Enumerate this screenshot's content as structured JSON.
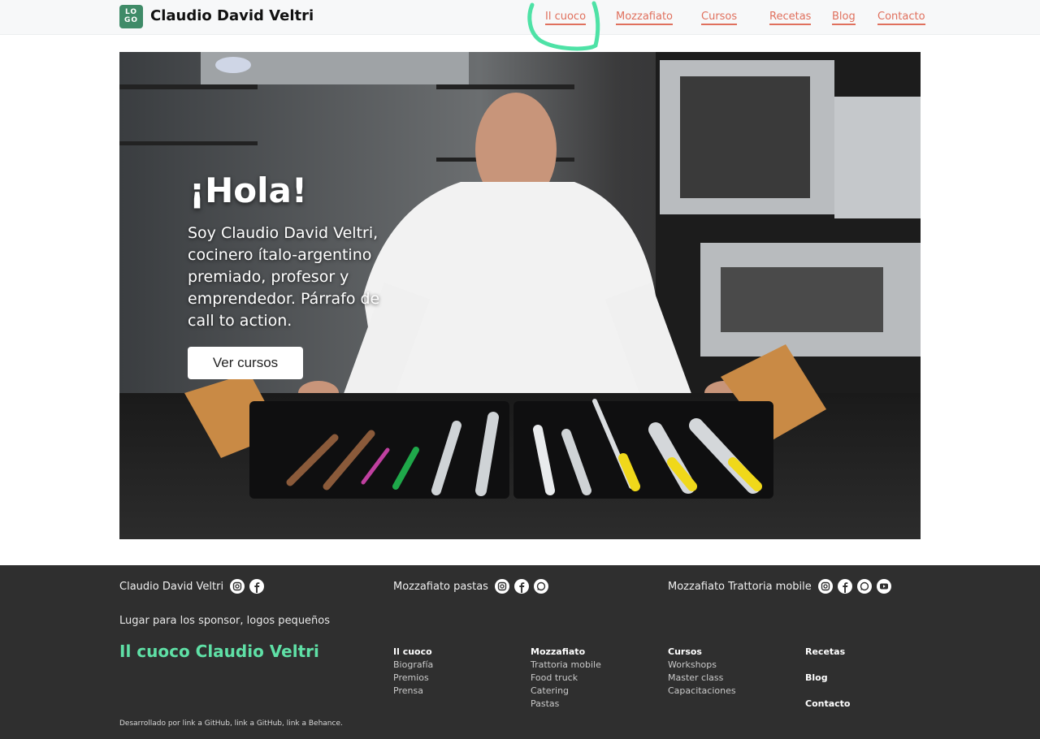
{
  "header": {
    "logo_text": [
      "LO",
      "GO"
    ],
    "brand": "Claudio David Veltri",
    "nav": [
      "Il cuoco",
      "Mozzafiato",
      "Cursos",
      "Recetas",
      "Blog",
      "Contacto"
    ]
  },
  "hero": {
    "title": "¡Hola!",
    "text": "Soy Claudio David Veltri, cocinero ítalo-argentino premiado, profesor y emprendedor. Párrafo de call to action.",
    "button": "Ver cursos"
  },
  "footer": {
    "col1": {
      "title": "Claudio David Veltri",
      "icons": [
        "instagram-icon",
        "facebook-icon"
      ]
    },
    "col2": {
      "title": "Mozzafiato pastas",
      "icons": [
        "instagram-icon",
        "facebook-icon",
        "whatsapp-icon"
      ]
    },
    "col3": {
      "title": "Mozzafiato Trattoria mobile",
      "icons": [
        "instagram-icon",
        "facebook-icon",
        "whatsapp-icon",
        "youtube-icon"
      ]
    },
    "sponsor": "Lugar para los sponsor, logos pequeños",
    "brand": "Il cuoco Claudio Veltri",
    "menus": [
      {
        "title": "Il cuoco",
        "items": [
          "Biografía",
          "Premios",
          "Prensa"
        ]
      },
      {
        "title": "Mozzafiato",
        "items": [
          "Trattoria mobile",
          "Food truck",
          "Catering",
          "Pastas"
        ]
      },
      {
        "title": "Cursos",
        "items": [
          "Workshops",
          "Master class",
          "Capacitaciones"
        ]
      },
      {
        "title": "Recetas",
        "items": []
      }
    ],
    "extra_links": [
      "Blog",
      "Contacto"
    ],
    "credits": "Desarrollado por link a GitHub, link a GitHub, link a Behance."
  },
  "colors": {
    "accent": "#e0705d",
    "brand_green": "#5fe0a6",
    "logo_green": "#3f8b68",
    "footer_bg": "#2f2f2f"
  }
}
